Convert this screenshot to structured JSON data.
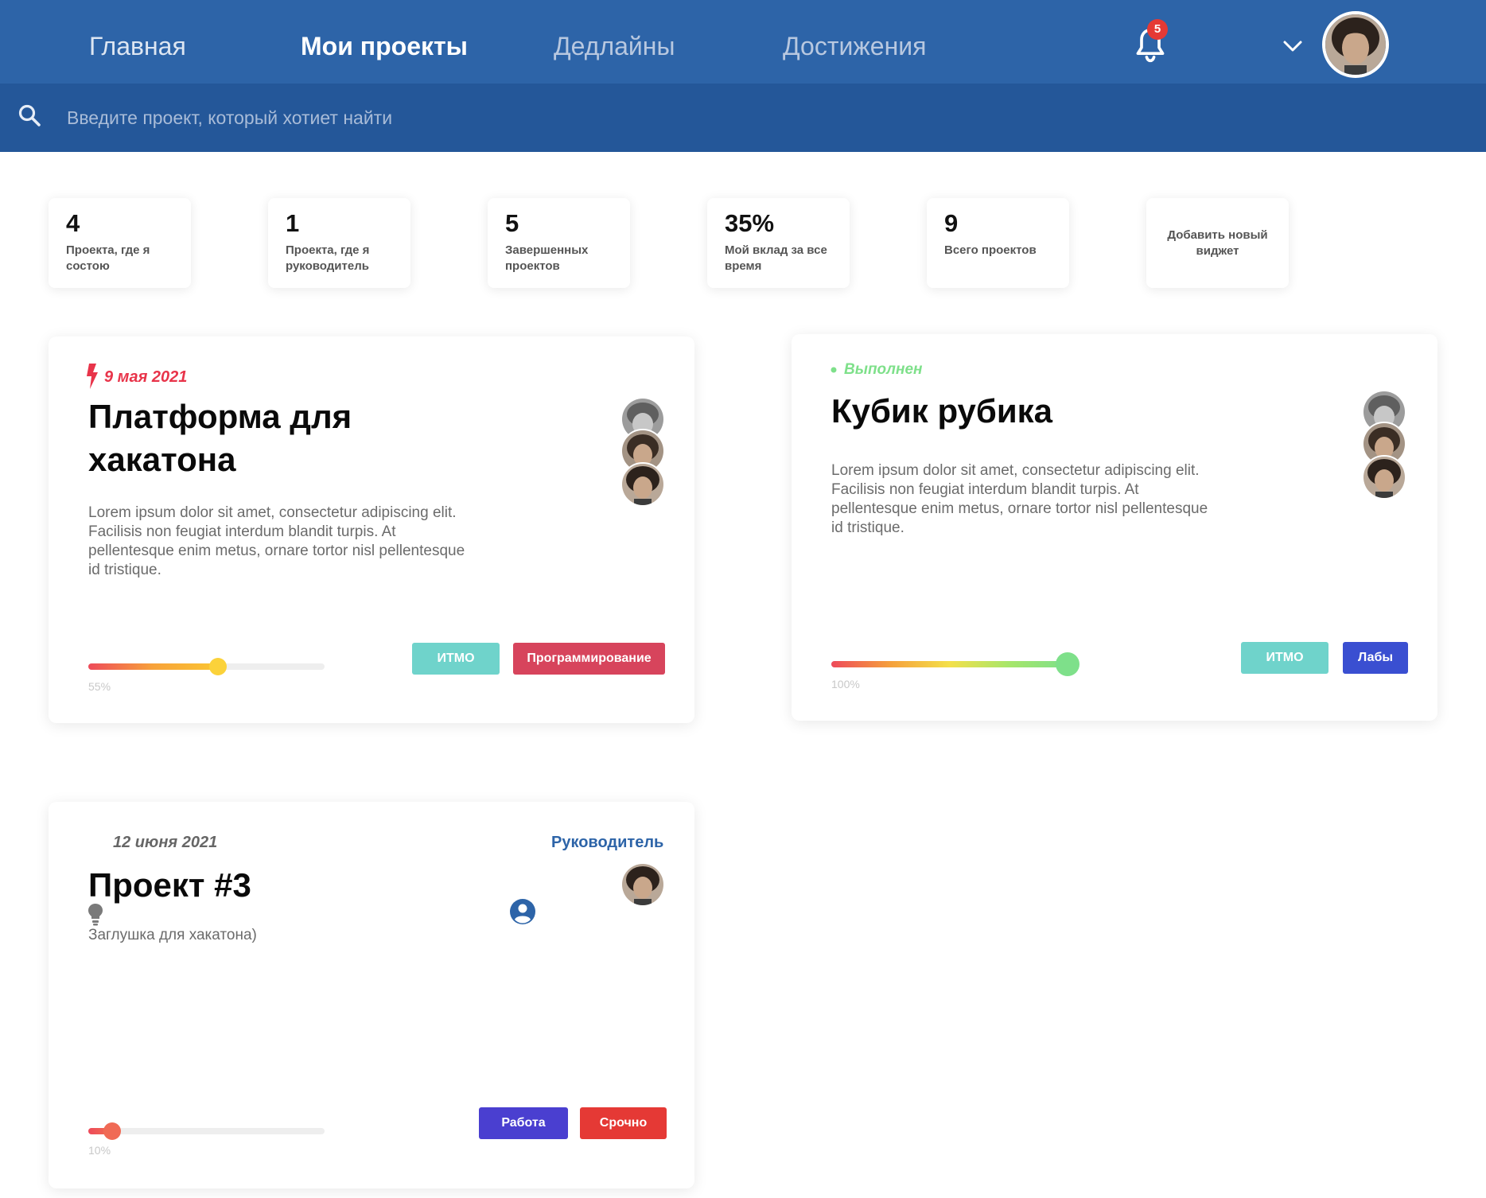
{
  "nav": {
    "items": [
      {
        "label": "Главная"
      },
      {
        "label": "Мои проекты"
      },
      {
        "label": "Дедлайны"
      },
      {
        "label": "Достижения"
      }
    ],
    "notification_count": "5"
  },
  "search": {
    "placeholder": "Введите проект, который хотиет найти"
  },
  "stats": [
    {
      "value": "4",
      "label": "Проекта, где я состою"
    },
    {
      "value": "1",
      "label": "Проекта, где я руководитель"
    },
    {
      "value": "5",
      "label": "Завершенных проектов"
    },
    {
      "value": "35%",
      "label": "Мой вклад за все время"
    },
    {
      "value": "9",
      "label": "Всего проектов"
    },
    {
      "label": "Добавить новый виджет"
    }
  ],
  "projects": [
    {
      "date": "9 мая 2021",
      "title": "Платформа для хакатона",
      "description": "Lorem ipsum dolor sit amet, consectetur adipiscing elit. Facilisis non feugiat interdum blandit turpis. At pellentesque enim metus, ornare tortor nisl pellentesque id tristique.",
      "progress_label": "55%",
      "progress": 0.55,
      "tags": [
        "ИТМО",
        "Программирование"
      ]
    },
    {
      "status": "Выполнен",
      "title": "Кубик рубика",
      "description": "Lorem ipsum dolor sit amet, consectetur adipiscing elit. Facilisis non feugiat interdum blandit turpis. At pellentesque enim metus, ornare tortor nisl pellentesque id tristique.",
      "progress_label": "100%",
      "progress": 1.0,
      "tags": [
        "ИТМО",
        "Лабы"
      ]
    },
    {
      "date": "12 июня 2021",
      "role": "Руководитель",
      "title": "Проект #3",
      "description": "Заглушка для хакатона)",
      "progress_label": "10%",
      "progress": 0.1,
      "tags": [
        "Работа",
        "Срочно"
      ]
    }
  ],
  "colors": {
    "nav_bg": "#2d64a8",
    "search_bg": "#245799",
    "deadline_red": "#e8344a",
    "done_green": "#7ee08a",
    "role_blue": "#2d64a8",
    "tag_itmo": "#6fd3cb",
    "tag_programming": "#d7445c",
    "tag_labs": "#3a4fd1",
    "tag_work": "#4a3fd0",
    "tag_urgent": "#e53935"
  },
  "icons": [
    "bell-icon",
    "chevron-down-icon",
    "search-icon",
    "lightning-icon",
    "status-dot-icon",
    "lightbulb-icon",
    "user-circle-icon"
  ]
}
